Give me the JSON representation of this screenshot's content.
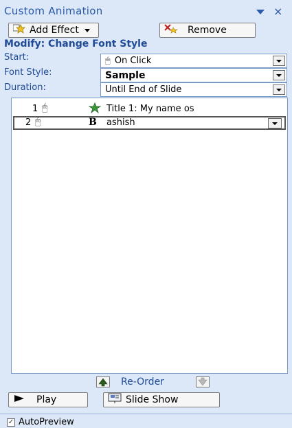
{
  "pane": {
    "title": "Custom Animation",
    "close_glyph": "×",
    "dropdown_icon": "triangle-down-icon"
  },
  "toolbar": {
    "add_effect_label": "Add Effect",
    "add_effect_icon": "star-effect-icon",
    "remove_label": "Remove",
    "remove_icon": "remove-effect-icon"
  },
  "modify": {
    "heading": "Modify: Change Font Style",
    "start_label": "Start:",
    "start_value": "On Click",
    "font_style_label": "Font Style:",
    "font_style_value": "Sample",
    "duration_label": "Duration:",
    "duration_value": "Until End of Slide"
  },
  "animations": [
    {
      "number": "1",
      "trigger_icon": "mouse-click-icon",
      "effect_icon": "star-effect-icon",
      "name": "Title 1: My name os",
      "selected": false
    },
    {
      "number": "2",
      "trigger_icon": "mouse-click-icon",
      "effect_icon": "bold-B-icon",
      "effect_glyph": "B",
      "name": "ashish",
      "selected": true
    }
  ],
  "reorder": {
    "label": "Re-Order",
    "up_icon": "arrow-up-icon",
    "down_icon": "arrow-down-icon"
  },
  "playback": {
    "play_label": "Play",
    "slideshow_label": "Slide Show"
  },
  "autopreview": {
    "label": "AutoPreview",
    "checked": true
  },
  "colors": {
    "pane_bg": "#dce8f8",
    "accent": "#1f4a96"
  }
}
